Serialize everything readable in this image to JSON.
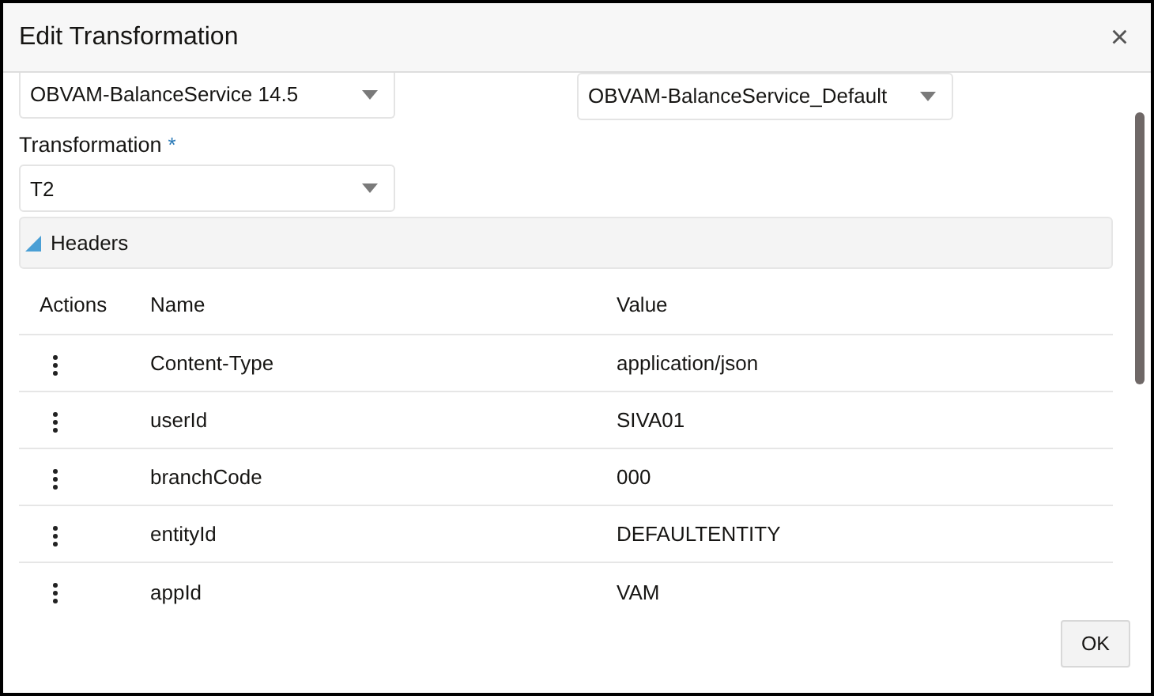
{
  "window": {
    "title": "Edit Transformation",
    "close": "×"
  },
  "selects": [
    {
      "value": "OBVAM-BalanceService 14.5"
    },
    {
      "value": "OBVAM-BalanceService_Default"
    }
  ],
  "transformation": {
    "label": "Transformation",
    "required_mark": "*",
    "value": "T2"
  },
  "headers_section": {
    "title": "Headers",
    "expanded": true
  },
  "table": {
    "columns": [
      "Actions",
      "Name",
      "Value"
    ],
    "rows": [
      {
        "name": "Content-Type",
        "value": "application/json"
      },
      {
        "name": "userId",
        "value": "SIVA01"
      },
      {
        "name": "branchCode",
        "value": "000"
      },
      {
        "name": "entityId",
        "value": "DEFAULTENTITY"
      },
      {
        "name": "appId",
        "value": "VAM"
      }
    ]
  },
  "buttons": [
    "OK"
  ]
}
